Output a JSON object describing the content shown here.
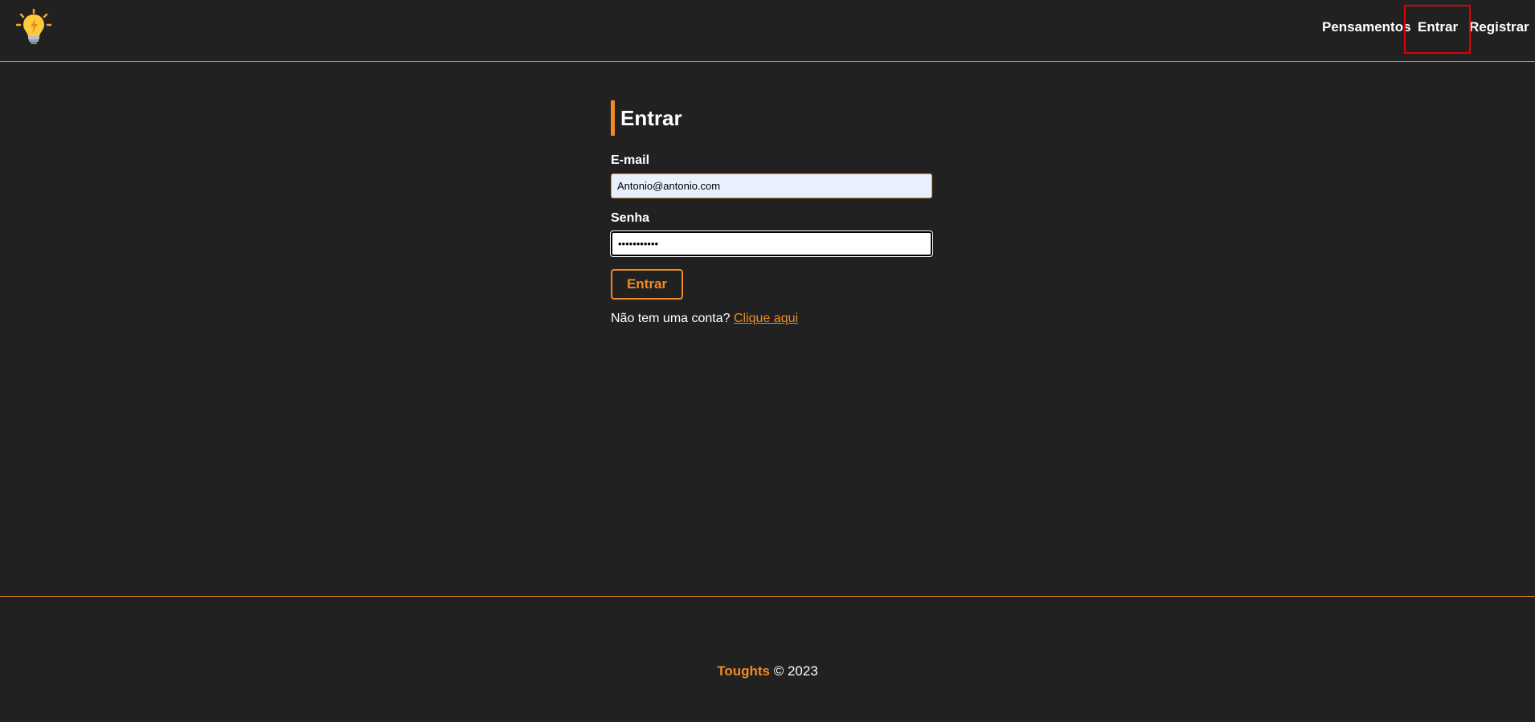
{
  "navbar": {
    "logo_icon": "lightbulb-icon",
    "links": {
      "pensamentos": "Pensamentos",
      "entrar": "Entrar",
      "registrar": "Registrar"
    }
  },
  "form": {
    "title": "Entrar",
    "email_label": "E-mail",
    "email_value": "Antonio@antonio.com",
    "password_label": "Senha",
    "password_value": "•••••••••••",
    "submit_label": "Entrar",
    "signup_text": "Não tem uma conta?",
    "signup_link": "Clique aqui"
  },
  "footer": {
    "brand": "Toughts",
    "copyright": "© 2023"
  },
  "colors": {
    "background": "#212121",
    "accent": "#f08a24",
    "highlight": "#e00000"
  }
}
